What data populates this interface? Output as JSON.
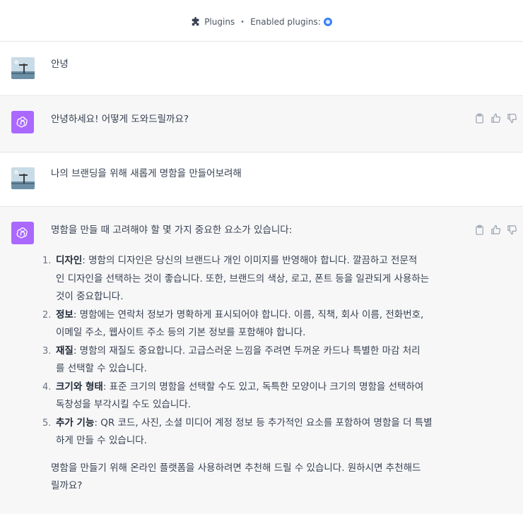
{
  "topbar": {
    "plugins_label": "Plugins",
    "separator": "•",
    "enabled_label": "Enabled plugins:"
  },
  "messages": [
    {
      "role": "user",
      "text": "안녕"
    },
    {
      "role": "assistant",
      "text": "안녕하세요! 어떻게 도와드릴까요?"
    },
    {
      "role": "user",
      "text": "나의 브랜딩을 위해 새롭게 명함을 만들어보려해"
    },
    {
      "role": "assistant",
      "intro": "명함을 만들 때 고려해야 할 몇 가지 중요한 요소가 있습니다:",
      "points": [
        {
          "num": "1.",
          "title": "디자인",
          "line1": ": 명함의 디자인은 당신의 브랜드나 개인 이미지를 반영해야 합니다. 깔끔하고 전문적",
          "line2": "인 디자인을 선택하는 것이 좋습니다. 또한, 브랜드의 색상, 로고, 폰트 등을 일관되게 사용하는",
          "line3": "것이 중요합니다."
        },
        {
          "num": "2.",
          "title": "정보",
          "line1": ": 명함에는 연락처 정보가 명확하게 표시되어야 합니다. 이름, 직책, 회사 이름, 전화번호,",
          "line2": "이메일 주소, 웹사이트 주소 등의 기본 정보를 포함해야 합니다."
        },
        {
          "num": "3.",
          "title": "재질",
          "line1": ": 명함의 재질도 중요합니다. 고급스러운 느낌을 주려면 두꺼운 카드나 특별한 마감 처리",
          "line2": "를 선택할 수 있습니다."
        },
        {
          "num": "4.",
          "title": "크기와 형태",
          "line1": ": 표준 크기의 명함을 선택할 수도 있고, 독특한 모양이나 크기의 명함을 선택하여",
          "line2": "독창성을 부각시킬 수도 있습니다."
        },
        {
          "num": "5.",
          "title": "추가 기능",
          "line1": ": QR 코드, 사진, 소셜 미디어 계정 정보 등 추가적인 요소를 포함하여 명함을 더 특별",
          "line2": "하게 만들 수 있습니다."
        }
      ],
      "outro_line1": "명함을 만들기 위해 온라인 플랫폼을 사용하려면 추천해 드릴 수 있습니다. 원하시면 추천해드",
      "outro_line2": "릴까요?"
    }
  ],
  "icons": [
    "puzzle-icon",
    "plugin-logo-icon",
    "openai-icon",
    "clipboard-icon",
    "thumbs-up-icon",
    "thumbs-down-icon",
    "user-avatar-icon"
  ],
  "colors": {
    "assistant_avatar": "#ab68ff",
    "assistant_bg": "#f7f7f8",
    "plugin_accent": "#3b82f6"
  }
}
